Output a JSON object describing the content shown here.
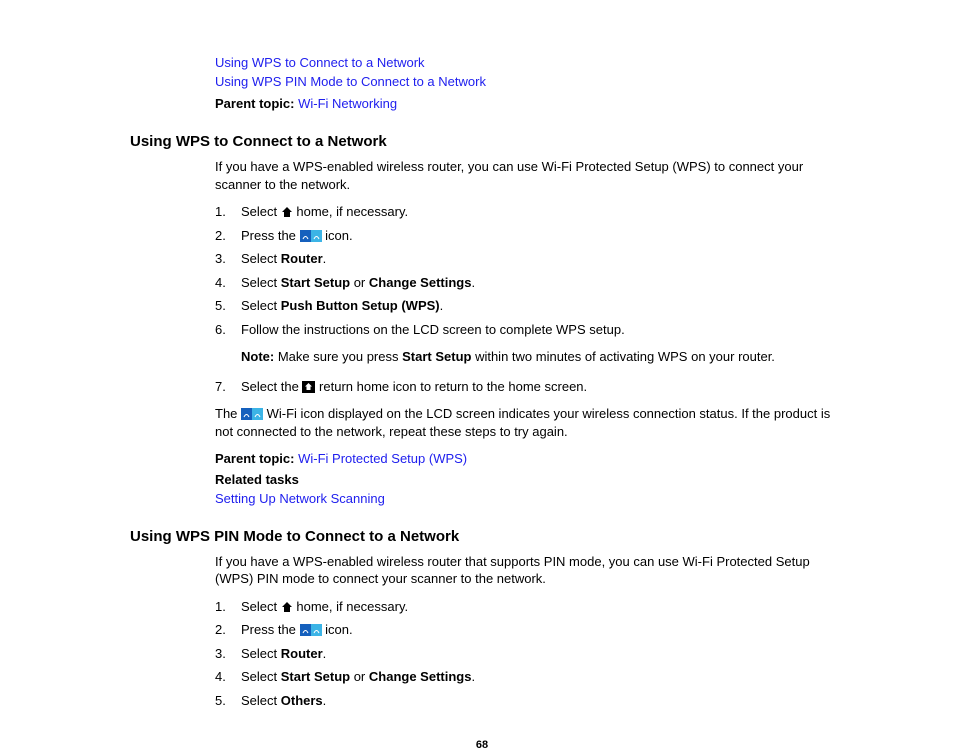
{
  "toc": {
    "link1": "Using WPS to Connect to a Network",
    "link2": "Using WPS PIN Mode to Connect to a Network",
    "parent_label": "Parent topic:",
    "parent_link": "Wi-Fi Networking"
  },
  "section1": {
    "heading": "Using WPS to Connect to a Network",
    "intro": "If you have a WPS-enabled wireless router, you can use Wi-Fi Protected Setup (WPS) to connect your scanner to the network.",
    "steps": {
      "s1_pre": "Select ",
      "s1_post": " home, if necessary.",
      "s2_pre": "Press the ",
      "s2_post": " icon.",
      "s3_pre": "Select ",
      "s3_bold": "Router",
      "s3_post": ".",
      "s4_pre": "Select ",
      "s4_b1": "Start Setup",
      "s4_mid": " or ",
      "s4_b2": "Change Settings",
      "s4_post": ".",
      "s5_pre": "Select ",
      "s5_bold": "Push Button Setup (WPS)",
      "s5_post": ".",
      "s6": "Follow the instructions on the LCD screen to complete WPS setup.",
      "s7_pre": "Select the ",
      "s7_post": " return home icon to return to the home screen."
    },
    "note_label": "Note:",
    "note_pre": " Make sure you press ",
    "note_bold": "Start Setup",
    "note_post": " within two minutes of activating WPS on your router.",
    "post_pre": "The ",
    "post_post": " Wi-Fi icon displayed on the LCD screen indicates your wireless connection status. If the product is not connected to the network, repeat these steps to try again.",
    "parent_label": "Parent topic:",
    "parent_link": "Wi-Fi Protected Setup (WPS)",
    "related_label": "Related tasks",
    "related_link": "Setting Up Network Scanning"
  },
  "section2": {
    "heading": "Using WPS PIN Mode to Connect to a Network",
    "intro": "If you have a WPS-enabled wireless router that supports PIN mode, you can use Wi-Fi Protected Setup (WPS) PIN mode to connect your scanner to the network.",
    "steps": {
      "s1_pre": "Select ",
      "s1_post": " home, if necessary.",
      "s2_pre": "Press the ",
      "s2_post": " icon.",
      "s3_pre": "Select ",
      "s3_bold": "Router",
      "s3_post": ".",
      "s4_pre": "Select ",
      "s4_b1": "Start Setup",
      "s4_mid": " or ",
      "s4_b2": "Change Settings",
      "s4_post": ".",
      "s5_pre": "Select ",
      "s5_bold": "Others",
      "s5_post": "."
    }
  },
  "page_number": "68"
}
